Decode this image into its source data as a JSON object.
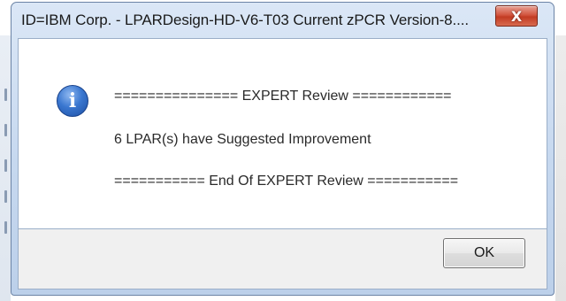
{
  "window": {
    "title": "ID=IBM Corp. - LPARDesign-HD-V6-T03     Current zPCR Version-8....",
    "close_glyph": "X"
  },
  "message": {
    "icon": "info-icon",
    "icon_glyph": "i",
    "review_header": "=============== EXPERT Review ============",
    "result": "6 LPAR(s) have Suggested Improvement",
    "review_footer": "=========== End Of EXPERT Review ==========="
  },
  "buttons": {
    "ok_label": "OK"
  },
  "colors": {
    "frame": "#c6d8ef",
    "close_button": "#c23b22",
    "icon_blue": "#3a77d0"
  }
}
